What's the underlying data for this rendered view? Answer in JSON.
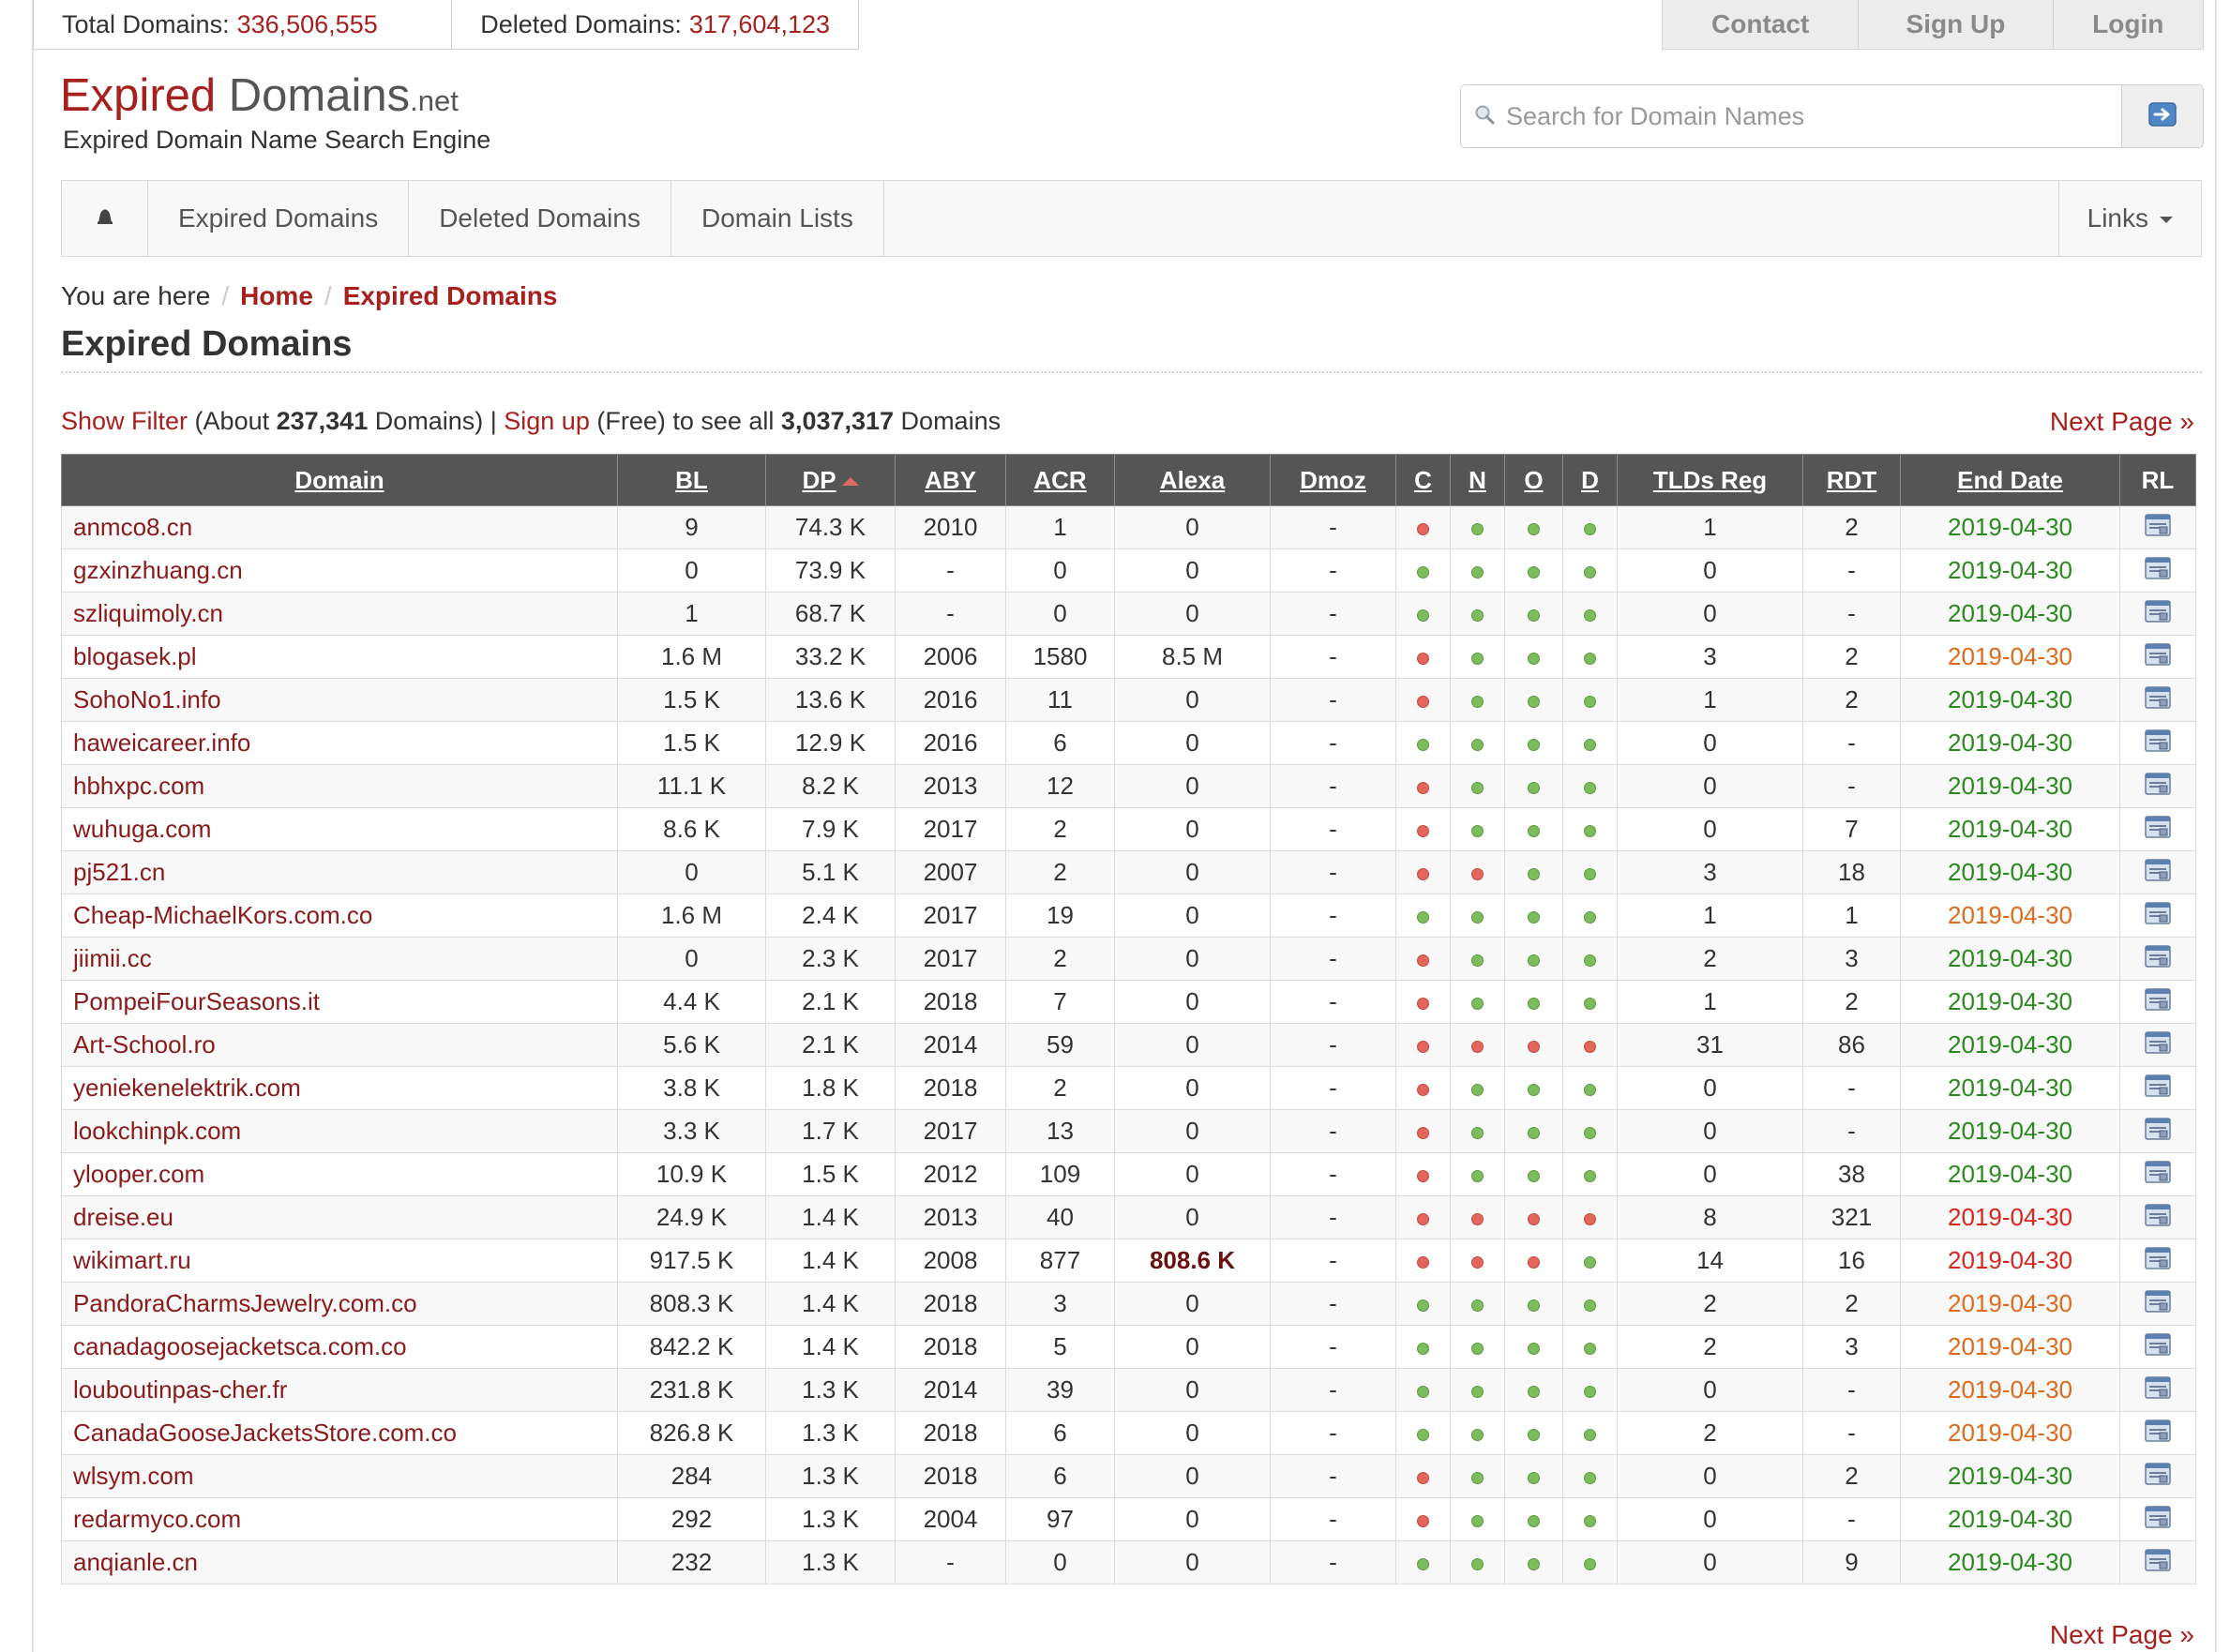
{
  "stats": {
    "total_label": "Total Domains:",
    "total_value": "336,506,555",
    "deleted_label": "Deleted Domains:",
    "deleted_value": "317,604,123"
  },
  "auth": {
    "contact": "Contact",
    "signup": "Sign Up",
    "login": "Login"
  },
  "logo": {
    "part1": "Expired",
    "part2": " Domains",
    "part3": ".net",
    "tagline": "Expired Domain Name Search Engine"
  },
  "search": {
    "placeholder": "Search for Domain Names"
  },
  "nav": {
    "items": [
      "Expired Domains",
      "Deleted Domains",
      "Domain Lists"
    ],
    "links": "Links"
  },
  "breadcrumb": {
    "prefix": "You are here",
    "home": "Home",
    "current": "Expired Domains"
  },
  "page_title": "Expired Domains",
  "info": {
    "show_filter": "Show Filter",
    "about_prefix": " (About ",
    "about_count": "237,341",
    "about_suffix": " Domains) | ",
    "sign_up": "Sign up",
    "free_text": " (Free) to see all ",
    "all_count": "3,037,317",
    "all_suffix": " Domains"
  },
  "next_page": "Next Page »",
  "table": {
    "columns": [
      "Domain",
      "BL",
      "DP",
      "ABY",
      "ACR",
      "Alexa",
      "Dmoz",
      "C",
      "N",
      "O",
      "D",
      "TLDs Reg",
      "RDT",
      "End Date",
      "RL"
    ],
    "rows": [
      {
        "domain": "anmco8.cn",
        "bl": "9",
        "dp": "74.3 K",
        "aby": "2010",
        "acr": "1",
        "alexa": "0",
        "dmoz": "-",
        "c": "r",
        "n": "g",
        "o": "g",
        "d": "g",
        "tlds": "1",
        "rdt": "2",
        "end": "2019-04-30",
        "end_color": "green",
        "alexa_bold": false
      },
      {
        "domain": "gzxinzhuang.cn",
        "bl": "0",
        "dp": "73.9 K",
        "aby": "-",
        "acr": "0",
        "alexa": "0",
        "dmoz": "-",
        "c": "g",
        "n": "g",
        "o": "g",
        "d": "g",
        "tlds": "0",
        "rdt": "-",
        "end": "2019-04-30",
        "end_color": "green",
        "alexa_bold": false
      },
      {
        "domain": "szliquimoly.cn",
        "bl": "1",
        "dp": "68.7 K",
        "aby": "-",
        "acr": "0",
        "alexa": "0",
        "dmoz": "-",
        "c": "g",
        "n": "g",
        "o": "g",
        "d": "g",
        "tlds": "0",
        "rdt": "-",
        "end": "2019-04-30",
        "end_color": "green",
        "alexa_bold": false
      },
      {
        "domain": "blogasek.pl",
        "bl": "1.6 M",
        "dp": "33.2 K",
        "aby": "2006",
        "acr": "1580",
        "alexa": "8.5 M",
        "dmoz": "-",
        "c": "r",
        "n": "g",
        "o": "g",
        "d": "g",
        "tlds": "3",
        "rdt": "2",
        "end": "2019-04-30",
        "end_color": "orange",
        "alexa_bold": false
      },
      {
        "domain": "SohoNo1.info",
        "bl": "1.5 K",
        "dp": "13.6 K",
        "aby": "2016",
        "acr": "11",
        "alexa": "0",
        "dmoz": "-",
        "c": "r",
        "n": "g",
        "o": "g",
        "d": "g",
        "tlds": "1",
        "rdt": "2",
        "end": "2019-04-30",
        "end_color": "green",
        "alexa_bold": false
      },
      {
        "domain": "haweicareer.info",
        "bl": "1.5 K",
        "dp": "12.9 K",
        "aby": "2016",
        "acr": "6",
        "alexa": "0",
        "dmoz": "-",
        "c": "g",
        "n": "g",
        "o": "g",
        "d": "g",
        "tlds": "0",
        "rdt": "-",
        "end": "2019-04-30",
        "end_color": "green",
        "alexa_bold": false
      },
      {
        "domain": "hbhxpc.com",
        "bl": "11.1 K",
        "dp": "8.2 K",
        "aby": "2013",
        "acr": "12",
        "alexa": "0",
        "dmoz": "-",
        "c": "r",
        "n": "g",
        "o": "g",
        "d": "g",
        "tlds": "0",
        "rdt": "-",
        "end": "2019-04-30",
        "end_color": "green",
        "alexa_bold": false
      },
      {
        "domain": "wuhuga.com",
        "bl": "8.6 K",
        "dp": "7.9 K",
        "aby": "2017",
        "acr": "2",
        "alexa": "0",
        "dmoz": "-",
        "c": "r",
        "n": "g",
        "o": "g",
        "d": "g",
        "tlds": "0",
        "rdt": "7",
        "end": "2019-04-30",
        "end_color": "green",
        "alexa_bold": false
      },
      {
        "domain": "pj521.cn",
        "bl": "0",
        "dp": "5.1 K",
        "aby": "2007",
        "acr": "2",
        "alexa": "0",
        "dmoz": "-",
        "c": "r",
        "n": "r",
        "o": "g",
        "d": "g",
        "tlds": "3",
        "rdt": "18",
        "end": "2019-04-30",
        "end_color": "green",
        "alexa_bold": false
      },
      {
        "domain": "Cheap-MichaelKors.com.co",
        "bl": "1.6 M",
        "dp": "2.4 K",
        "aby": "2017",
        "acr": "19",
        "alexa": "0",
        "dmoz": "-",
        "c": "g",
        "n": "g",
        "o": "g",
        "d": "g",
        "tlds": "1",
        "rdt": "1",
        "end": "2019-04-30",
        "end_color": "orange",
        "alexa_bold": false
      },
      {
        "domain": "jiimii.cc",
        "bl": "0",
        "dp": "2.3 K",
        "aby": "2017",
        "acr": "2",
        "alexa": "0",
        "dmoz": "-",
        "c": "r",
        "n": "g",
        "o": "g",
        "d": "g",
        "tlds": "2",
        "rdt": "3",
        "end": "2019-04-30",
        "end_color": "green",
        "alexa_bold": false
      },
      {
        "domain": "PompeiFourSeasons.it",
        "bl": "4.4 K",
        "dp": "2.1 K",
        "aby": "2018",
        "acr": "7",
        "alexa": "0",
        "dmoz": "-",
        "c": "r",
        "n": "g",
        "o": "g",
        "d": "g",
        "tlds": "1",
        "rdt": "2",
        "end": "2019-04-30",
        "end_color": "green",
        "alexa_bold": false
      },
      {
        "domain": "Art-School.ro",
        "bl": "5.6 K",
        "dp": "2.1 K",
        "aby": "2014",
        "acr": "59",
        "alexa": "0",
        "dmoz": "-",
        "c": "r",
        "n": "r",
        "o": "r",
        "d": "r",
        "tlds": "31",
        "rdt": "86",
        "end": "2019-04-30",
        "end_color": "green",
        "alexa_bold": false
      },
      {
        "domain": "yeniekenelektrik.com",
        "bl": "3.8 K",
        "dp": "1.8 K",
        "aby": "2018",
        "acr": "2",
        "alexa": "0",
        "dmoz": "-",
        "c": "r",
        "n": "g",
        "o": "g",
        "d": "g",
        "tlds": "0",
        "rdt": "-",
        "end": "2019-04-30",
        "end_color": "green",
        "alexa_bold": false
      },
      {
        "domain": "lookchinpk.com",
        "bl": "3.3 K",
        "dp": "1.7 K",
        "aby": "2017",
        "acr": "13",
        "alexa": "0",
        "dmoz": "-",
        "c": "r",
        "n": "g",
        "o": "g",
        "d": "g",
        "tlds": "0",
        "rdt": "-",
        "end": "2019-04-30",
        "end_color": "green",
        "alexa_bold": false
      },
      {
        "domain": "ylooper.com",
        "bl": "10.9 K",
        "dp": "1.5 K",
        "aby": "2012",
        "acr": "109",
        "alexa": "0",
        "dmoz": "-",
        "c": "r",
        "n": "g",
        "o": "g",
        "d": "g",
        "tlds": "0",
        "rdt": "38",
        "end": "2019-04-30",
        "end_color": "green",
        "alexa_bold": false
      },
      {
        "domain": "dreise.eu",
        "bl": "24.9 K",
        "dp": "1.4 K",
        "aby": "2013",
        "acr": "40",
        "alexa": "0",
        "dmoz": "-",
        "c": "r",
        "n": "r",
        "o": "r",
        "d": "r",
        "tlds": "8",
        "rdt": "321",
        "end": "2019-04-30",
        "end_color": "red",
        "alexa_bold": false
      },
      {
        "domain": "wikimart.ru",
        "bl": "917.5 K",
        "dp": "1.4 K",
        "aby": "2008",
        "acr": "877",
        "alexa": "808.6 K",
        "dmoz": "-",
        "c": "r",
        "n": "r",
        "o": "r",
        "d": "g",
        "tlds": "14",
        "rdt": "16",
        "end": "2019-04-30",
        "end_color": "red",
        "alexa_bold": true
      },
      {
        "domain": "PandoraCharmsJewelry.com.co",
        "bl": "808.3 K",
        "dp": "1.4 K",
        "aby": "2018",
        "acr": "3",
        "alexa": "0",
        "dmoz": "-",
        "c": "g",
        "n": "g",
        "o": "g",
        "d": "g",
        "tlds": "2",
        "rdt": "2",
        "end": "2019-04-30",
        "end_color": "orange",
        "alexa_bold": false
      },
      {
        "domain": "canadagoosejacketsca.com.co",
        "bl": "842.2 K",
        "dp": "1.4 K",
        "aby": "2018",
        "acr": "5",
        "alexa": "0",
        "dmoz": "-",
        "c": "g",
        "n": "g",
        "o": "g",
        "d": "g",
        "tlds": "2",
        "rdt": "3",
        "end": "2019-04-30",
        "end_color": "orange",
        "alexa_bold": false
      },
      {
        "domain": "louboutinpas-cher.fr",
        "bl": "231.8 K",
        "dp": "1.3 K",
        "aby": "2014",
        "acr": "39",
        "alexa": "0",
        "dmoz": "-",
        "c": "g",
        "n": "g",
        "o": "g",
        "d": "g",
        "tlds": "0",
        "rdt": "-",
        "end": "2019-04-30",
        "end_color": "orange",
        "alexa_bold": false
      },
      {
        "domain": "CanadaGooseJacketsStore.com.co",
        "bl": "826.8 K",
        "dp": "1.3 K",
        "aby": "2018",
        "acr": "6",
        "alexa": "0",
        "dmoz": "-",
        "c": "g",
        "n": "g",
        "o": "g",
        "d": "g",
        "tlds": "2",
        "rdt": "-",
        "end": "2019-04-30",
        "end_color": "orange",
        "alexa_bold": false
      },
      {
        "domain": "wlsym.com",
        "bl": "284",
        "dp": "1.3 K",
        "aby": "2018",
        "acr": "6",
        "alexa": "0",
        "dmoz": "-",
        "c": "r",
        "n": "g",
        "o": "g",
        "d": "g",
        "tlds": "0",
        "rdt": "2",
        "end": "2019-04-30",
        "end_color": "green",
        "alexa_bold": false
      },
      {
        "domain": "redarmyco.com",
        "bl": "292",
        "dp": "1.3 K",
        "aby": "2004",
        "acr": "97",
        "alexa": "0",
        "dmoz": "-",
        "c": "r",
        "n": "g",
        "o": "g",
        "d": "g",
        "tlds": "0",
        "rdt": "-",
        "end": "2019-04-30",
        "end_color": "green",
        "alexa_bold": false
      },
      {
        "domain": "anqianle.cn",
        "bl": "232",
        "dp": "1.3 K",
        "aby": "-",
        "acr": "0",
        "alexa": "0",
        "dmoz": "-",
        "c": "g",
        "n": "g",
        "o": "g",
        "d": "g",
        "tlds": "0",
        "rdt": "9",
        "end": "2019-04-30",
        "end_color": "green",
        "alexa_bold": false
      }
    ]
  },
  "colors": {
    "brand_red": "#a6201e",
    "header_gray": "#555555",
    "end_green": "#2a8a1d",
    "end_orange": "#e06a1c",
    "end_red": "#d9261c"
  },
  "icons": {
    "bell": "bell-icon",
    "search": "search-icon",
    "submit": "arrow-right-icon",
    "rl": "registrar-list-icon"
  }
}
